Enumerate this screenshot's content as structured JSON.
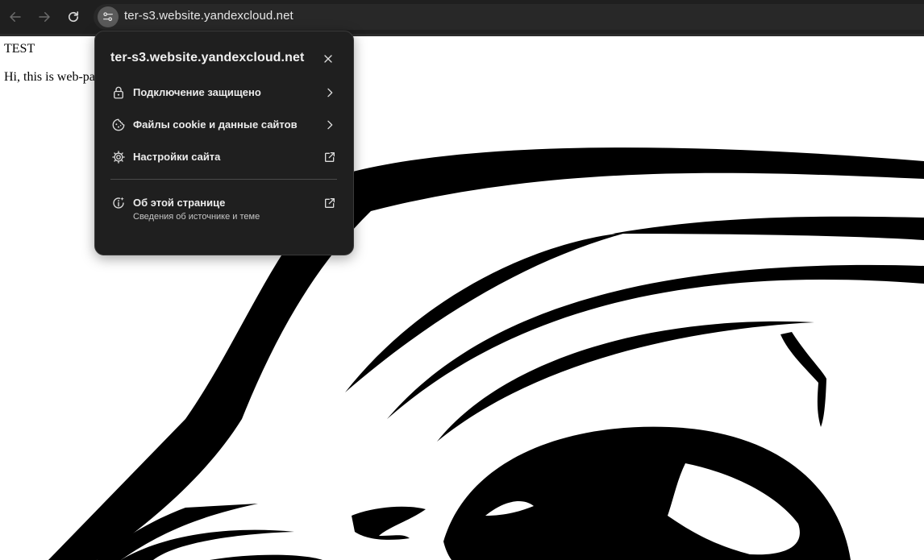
{
  "browser": {
    "url": "ter-s3.website.yandexcloud.net",
    "icons": {
      "back": "arrow-left-icon",
      "forward": "arrow-right-icon",
      "reload": "reload-icon",
      "site_info": "tune-icon"
    }
  },
  "page": {
    "heading": "TEST",
    "paragraph": "Hi, this is web-pa"
  },
  "popup": {
    "title": "ter-s3.website.yandexcloud.net",
    "items": [
      {
        "label": "Подключение защищено",
        "icon": "lock-icon",
        "trailing": "chevron-right-icon"
      },
      {
        "label": "Файлы cookie и данные сайтов",
        "icon": "cookie-icon",
        "trailing": "chevron-right-icon"
      },
      {
        "label": "Настройки сайта",
        "icon": "gear-icon",
        "trailing": "open-external-icon"
      },
      {
        "label": "Об этой странице",
        "sublabel": "Сведения об источнике и теме",
        "icon": "info-sparkle-icon",
        "trailing": "open-external-icon"
      }
    ]
  },
  "colors": {
    "toolbar": "#1f1f1f",
    "omnibox": "#282828",
    "popup_bg": "#1f1f1f",
    "popup_text": "#ececec",
    "page_bg": "#ffffff"
  }
}
